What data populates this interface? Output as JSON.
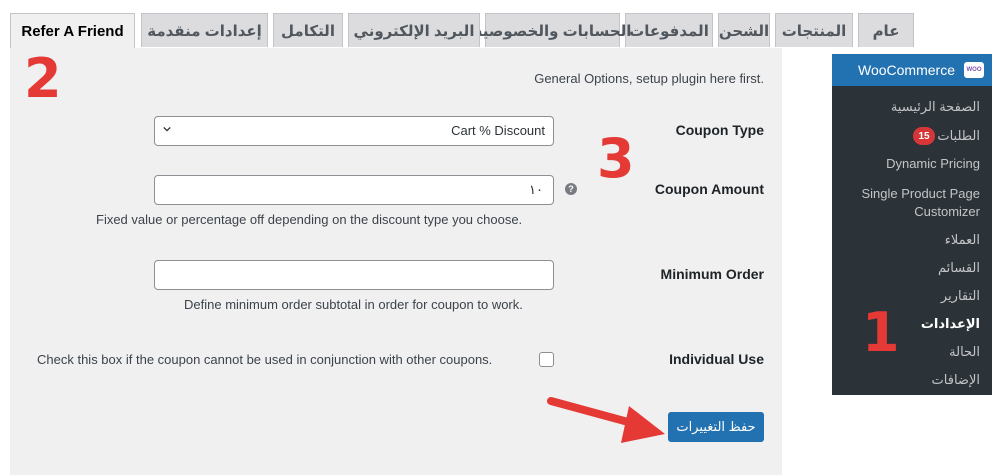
{
  "tabs": [
    {
      "label": "عام"
    },
    {
      "label": "المنتجات"
    },
    {
      "label": "الشحن"
    },
    {
      "label": "المدفوعات"
    },
    {
      "label": "الحسابات والخصوصية"
    },
    {
      "label": "البريد الإلكتروني"
    },
    {
      "label": "التكامل"
    },
    {
      "label": "إعدادات منقدمة"
    },
    {
      "label": "Refer A Friend"
    }
  ],
  "settings": {
    "description": "General Options, setup plugin here first.",
    "coupon_type": {
      "label": "Coupon Type",
      "value": "Cart % Discount"
    },
    "coupon_amount": {
      "label": "Coupon Amount",
      "value": "١٠",
      "help": "?",
      "description": "Fixed value or percentage off depending on the discount type you choose."
    },
    "minimum_order": {
      "label": "Minimum Order",
      "value": "",
      "description": "Define minimum order subtotal in order for coupon to work."
    },
    "individual_use": {
      "label": "Individual Use",
      "checkbox_text": "Check this box if the coupon cannot be used in conjunction with other coupons.",
      "checked": false
    },
    "save_label": "حفظ التغييرات"
  },
  "sidebar": {
    "title": "WooCommerce",
    "logo_text": "WOO",
    "items": [
      {
        "label": "الصفحة الرئيسية"
      },
      {
        "label": "الطلبات",
        "badge": "15"
      },
      {
        "label": "Dynamic Pricing"
      },
      {
        "label": "Single Product Page"
      },
      {
        "label": "Customizer"
      },
      {
        "label": "العملاء"
      },
      {
        "label": "القسائم"
      },
      {
        "label": "التقارير"
      },
      {
        "label": "الإعدادات"
      },
      {
        "label": "الحالة"
      },
      {
        "label": "الإضافات"
      }
    ]
  },
  "annotations": {
    "one": "1",
    "two": "2",
    "three": "3"
  },
  "colors": {
    "accent": "#2271b1",
    "annotation": "#e53935",
    "badge": "#d63638",
    "sidebar_bg": "#2c3338"
  }
}
